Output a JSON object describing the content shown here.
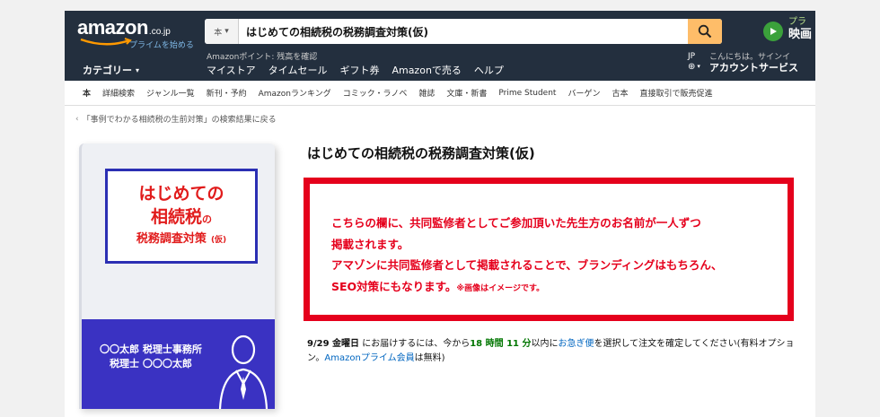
{
  "header": {
    "logo_word": "amazon",
    "logo_suffix": ".co.jp",
    "logo_prime": "プライムを始める",
    "search_category": "本",
    "search_value": "はじめての相続税の税務調査対策(仮)",
    "promo_line1": "プラ",
    "promo_line2": "映画",
    "nav_note": "Amazonポイント: 残高を確認",
    "category_label": "カテゴリー",
    "nav_links": [
      "マイストア",
      "タイムセール",
      "ギフト券",
      "Amazonで売る",
      "ヘルプ"
    ],
    "lang": "JP",
    "account_greeting": "こんにちは。サインイ",
    "account_main": "アカウントサービス"
  },
  "subnav": [
    "本",
    "詳細検索",
    "ジャンル一覧",
    "新刊・予約",
    "Amazonランキング",
    "コミック・ラノベ",
    "雑誌",
    "文庫・新書",
    "Prime Student",
    "バーゲン",
    "古本",
    "直接取引で販売促進"
  ],
  "back_link": "「事例でわかる相続税の生前対策」の検索結果に戻る",
  "cover": {
    "title_line1": "はじめての",
    "title_line2": "相続税",
    "title_line2_suffix": "の",
    "title_line3": "税務調査対策",
    "title_line3_suffix": "(仮)",
    "author_line1": "〇〇太郎 税理士事務所",
    "author_line2": "税理士 〇〇〇太郎"
  },
  "product": {
    "title": "はじめての相続税の税務調査対策(仮)",
    "notice_lines": [
      "こちらの欄に、共同監修者としてご参加頂いた先生方のお名前が一人ずつ",
      "掲載されます。",
      "アマゾンに共同監修者として掲載されることで、ブランディングはもちろん、",
      "SEO対策にもなります。"
    ],
    "notice_small": "※画像はイメージです。"
  },
  "delivery": {
    "date": "9/29 金曜日",
    "text1": " にお届けするには、今から",
    "hours": "18 時間 11 分",
    "text2": "以内に",
    "express": "お急ぎ便",
    "text3": "を選択して注文を確定してください(有料オプション。",
    "prime_link": "Amazonプライム会員",
    "text4": "は無料)"
  },
  "colors": {
    "header_bg": "#232f3e",
    "search_button": "#febd69",
    "notice_red": "#e5001c",
    "cover_blue": "#3a32c2",
    "link_blue": "#0066c0",
    "countdown_green": "#007600"
  }
}
